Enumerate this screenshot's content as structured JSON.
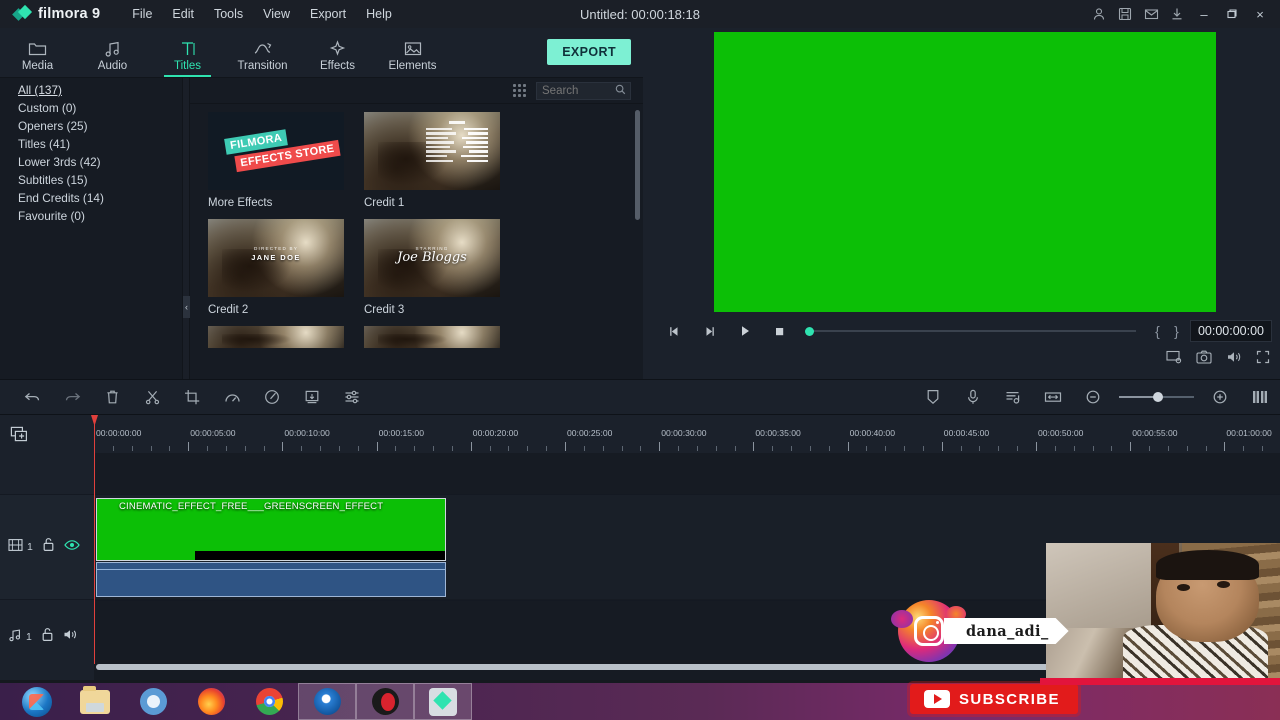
{
  "app": {
    "brand": "filmora 9",
    "project_title": "Untitled:  00:00:18:18"
  },
  "menu": {
    "items": [
      {
        "label": "File"
      },
      {
        "label": "Edit"
      },
      {
        "label": "Tools"
      },
      {
        "label": "View"
      },
      {
        "label": "Export"
      },
      {
        "label": "Help"
      }
    ]
  },
  "titlebar_icons": [
    {
      "name": "account-icon"
    },
    {
      "name": "save-icon"
    },
    {
      "name": "mail-icon"
    },
    {
      "name": "download-icon"
    }
  ],
  "window_controls": {
    "minimize": "–",
    "restore": "❐",
    "close": "×"
  },
  "toolbar": {
    "tabs": [
      {
        "label": "Media",
        "icon": "folder-icon",
        "active": false
      },
      {
        "label": "Audio",
        "icon": "music-note-icon",
        "active": false
      },
      {
        "label": "Titles",
        "icon": "text-tool-icon",
        "active": true
      },
      {
        "label": "Transition",
        "icon": "transition-icon",
        "active": false
      },
      {
        "label": "Effects",
        "icon": "sparkle-icon",
        "active": false
      },
      {
        "label": "Elements",
        "icon": "image-icon",
        "active": false
      }
    ],
    "export_label": "EXPORT"
  },
  "library": {
    "search_placeholder": "Search",
    "search_value": "",
    "categories": [
      {
        "label": "All (137)",
        "selected": true
      },
      {
        "label": "Custom (0)",
        "selected": false
      },
      {
        "label": "Openers (25)",
        "selected": false
      },
      {
        "label": "Titles (41)",
        "selected": false
      },
      {
        "label": "Lower 3rds (42)",
        "selected": false
      },
      {
        "label": "Subtitles (15)",
        "selected": false
      },
      {
        "label": "End Credits (14)",
        "selected": false
      },
      {
        "label": "Favourite (0)",
        "selected": false
      }
    ],
    "items": [
      {
        "label": "More Effects",
        "kind": "store",
        "badge1": "FILMORA",
        "badge2": "EFFECTS STORE"
      },
      {
        "label": "Credit 1",
        "kind": "credit-roll"
      },
      {
        "label": "Credit 2",
        "kind": "credit-name",
        "name": "JANE DOE",
        "sub": "DIRECTED BY"
      },
      {
        "label": "Credit 3",
        "kind": "credit-script",
        "name": "Joe Bloggs",
        "sub": "STARRING"
      }
    ],
    "collapse_icon": "‹"
  },
  "preview": {
    "green_color": "#0cbf06",
    "timecode": "00:00:00:00",
    "mark_in": "{",
    "mark_out": "}",
    "controls": [
      {
        "name": "previous-frame-button"
      },
      {
        "name": "next-frame-button"
      },
      {
        "name": "play-button"
      },
      {
        "name": "stop-button"
      }
    ],
    "bottom_controls": [
      {
        "name": "display-settings-icon"
      },
      {
        "name": "snapshot-icon"
      },
      {
        "name": "volume-icon"
      },
      {
        "name": "fullscreen-icon"
      }
    ]
  },
  "timeline_toolbar": {
    "left_tools": [
      {
        "name": "undo-button"
      },
      {
        "name": "redo-button"
      },
      {
        "name": "delete-button"
      },
      {
        "name": "split-button"
      },
      {
        "name": "crop-button"
      },
      {
        "name": "speed-button"
      },
      {
        "name": "color-button"
      },
      {
        "name": "snapshot-button"
      },
      {
        "name": "audio-mixer-button"
      }
    ],
    "right_tools": [
      {
        "name": "marker-button"
      },
      {
        "name": "voiceover-button"
      },
      {
        "name": "detach-audio-button"
      },
      {
        "name": "fit-timeline-button"
      }
    ],
    "zoom_out": "⊖",
    "zoom_in": "⊕",
    "zoom_value": 52
  },
  "timeline": {
    "add_track_icon": "add-track-icon",
    "ruler_ticks": [
      "00:00:00:00",
      "00:00:05:00",
      "00:00:10:00",
      "00:00:15:00",
      "00:00:20:00",
      "00:00:25:00",
      "00:00:30:00",
      "00:00:35:00",
      "00:00:40:00",
      "00:00:45:00",
      "00:00:50:00",
      "00:00:55:00",
      "00:01:00:00"
    ],
    "tracks": [
      {
        "type": "video",
        "number": "1",
        "lock": "unlocked",
        "visibility": "visible"
      },
      {
        "type": "audio",
        "number": "1",
        "lock": "unlocked",
        "mute": "unmuted"
      }
    ],
    "clip": {
      "title": "CINEMATIC_EFFECT_FREE___GREENSCREEN_EFFECT",
      "video_color": "#0cbf06",
      "audio_color": "#2f5484"
    }
  },
  "overlays": {
    "instagram_handle": "dana_adi_",
    "subscribe_label": "SUBSCRIBE"
  },
  "taskbar": {
    "items": [
      {
        "name": "start-orb"
      },
      {
        "name": "file-explorer-icon"
      },
      {
        "name": "chromium-icon"
      },
      {
        "name": "firefox-icon"
      },
      {
        "name": "chrome-icon"
      },
      {
        "name": "blue-disc-app-icon"
      },
      {
        "name": "screen-recorder-icon"
      },
      {
        "name": "filmora-taskbar-icon"
      }
    ]
  }
}
